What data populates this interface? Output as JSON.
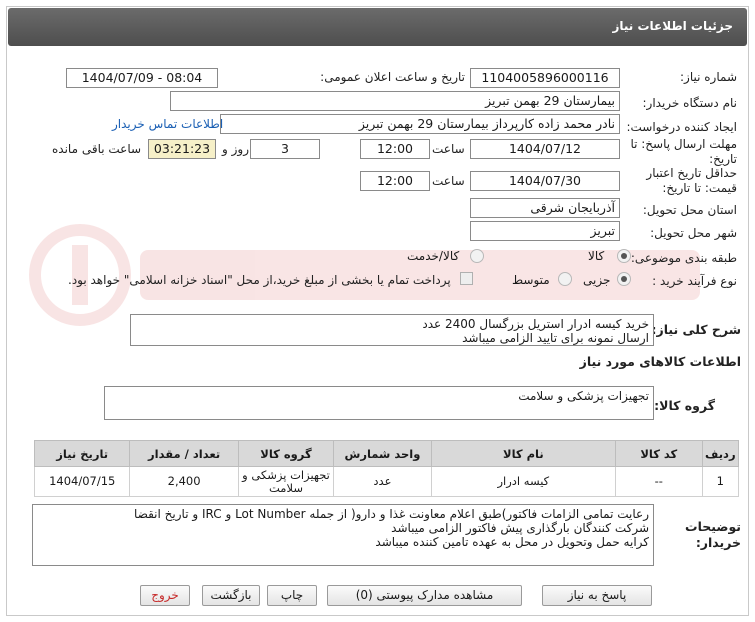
{
  "header": {
    "title": "جزئیات اطلاعات نیاز"
  },
  "fields": {
    "need_number_label": "شماره نیاز:",
    "need_number": "1104005896000116",
    "announce_label": "تاریخ و ساعت اعلان عمومی:",
    "announce_value": "1404/07/09 - 08:04",
    "buyer_org_label": "نام دستگاه خریدار:",
    "buyer_org": "بیمارستان 29 بهمن تبریز",
    "creator_label": "ایجاد کننده درخواست:",
    "creator": "نادر محمد زاده کارپرداز بیمارستان 29 بهمن تبریز",
    "contact_link": "اطلاعات تماس خریدار",
    "reply_deadline_label": "مهلت ارسال پاسخ: تا تاریخ:",
    "reply_date": "1404/07/12",
    "time_label": "ساعت",
    "reply_time": "12:00",
    "days_value": "3",
    "days_label": "روز و",
    "remaining_time": "03:21:23",
    "remaining_label": "ساعت باقی مانده",
    "validity_label": "حداقل تاریخ اعتبار قیمت: تا تاریخ:",
    "validity_date": "1404/07/30",
    "validity_time": "12:00",
    "province_label": "استان محل تحویل:",
    "province": "آذربایجان شرقی",
    "city_label": "شهر محل تحویل:",
    "city": "تبریز",
    "category_label": "طبقه بندی موضوعی:",
    "category_options": [
      "کالا",
      "کالا/خدمت"
    ],
    "process_label": "نوع فرآیند خرید :",
    "process_options": [
      "جزیی",
      "متوسط"
    ],
    "payment_note": "پرداخت تمام یا بخشی از مبلغ خرید،از محل \"اسناد خزانه اسلامی\" خواهد بود."
  },
  "summary": {
    "label": "شرح کلی نیاز:",
    "line1": "خرید کیسه ادرار استریل بزرگسال 2400 عدد",
    "line2": "ارسال نمونه برای تایید الزامی میباشد"
  },
  "goods": {
    "section_title": "اطلاعات کالاهای مورد نیاز",
    "group_label": "گروه کالا:",
    "group_value": "تجهیزات پزشکی و سلامت"
  },
  "table": {
    "headers": [
      "ردیف",
      "کد کالا",
      "نام کالا",
      "واحد شمارش",
      "گروه کالا",
      "تعداد / مقدار",
      "تاریخ نیاز"
    ],
    "rows": [
      [
        "1",
        "--",
        "کیسه ادرار",
        "عدد",
        "تجهیزات پزشکی و سلامت",
        "2,400",
        "1404/07/15"
      ]
    ]
  },
  "notes": {
    "label": "توضیحات خریدار:",
    "line1": "رعایت تمامی الزامات فاکتور)طبق اعلام معاونت غذا و دارو( از جمله Lot Number و IRC و تاریخ انقضا",
    "line2": "شرکت کنندگان بارگذاری پیش فاکتور الزامی میباشد",
    "line3": "کرایه حمل وتحویل در محل به عهده تامین کننده میباشد"
  },
  "buttons": {
    "reply": "پاسخ به نیاز",
    "attachments": "مشاهده مدارک پیوستی (0)",
    "print": "چاپ",
    "back": "بازگشت",
    "exit": "خروج"
  },
  "colors": {
    "header_bg": "#5a5a5a",
    "link": "#1a5fb4",
    "highlight": "#f6f0c8",
    "exit_text": "#c62828"
  }
}
